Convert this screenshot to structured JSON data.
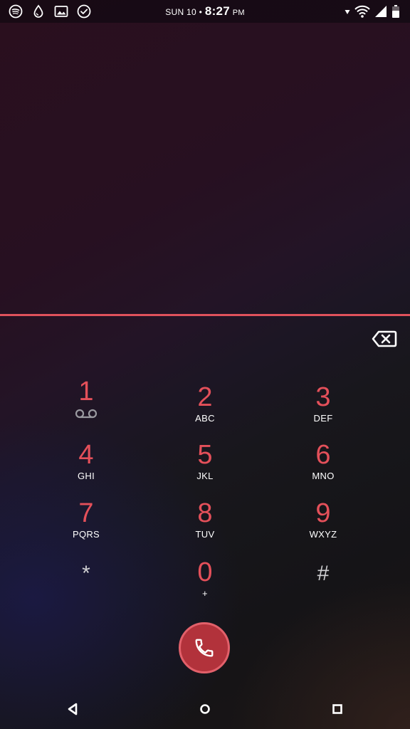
{
  "status_bar": {
    "date": "SUN 10",
    "separator": "•",
    "time": "8:27",
    "ampm": "PM",
    "left_icons": [
      "spotify-icon",
      "water-drop-icon",
      "image-icon",
      "check-circle-icon"
    ],
    "right_icons": [
      "data-arrow-icon",
      "wifi-icon",
      "cell-signal-icon",
      "battery-icon"
    ]
  },
  "dialer": {
    "number": "",
    "accent_color": "#e4505a",
    "keys": [
      {
        "digit": "1",
        "letters": "",
        "sub_icon": "voicemail-icon"
      },
      {
        "digit": "2",
        "letters": "ABC"
      },
      {
        "digit": "3",
        "letters": "DEF"
      },
      {
        "digit": "4",
        "letters": "GHI"
      },
      {
        "digit": "5",
        "letters": "JKL"
      },
      {
        "digit": "6",
        "letters": "MNO"
      },
      {
        "digit": "7",
        "letters": "PQRS"
      },
      {
        "digit": "8",
        "letters": "TUV"
      },
      {
        "digit": "9",
        "letters": "WXYZ"
      },
      {
        "digit": "*",
        "letters": ""
      },
      {
        "digit": "0",
        "letters": "+"
      },
      {
        "digit": "#",
        "letters": ""
      }
    ],
    "call_button_color": "#b2323b"
  },
  "nav_bar": {
    "icons": [
      "back-icon",
      "home-icon",
      "recents-icon"
    ]
  }
}
